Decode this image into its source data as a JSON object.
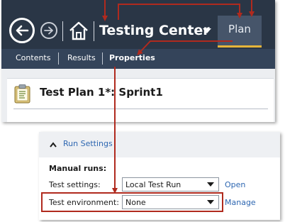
{
  "header": {
    "title": "Testing Center",
    "plan_tab": "Plan"
  },
  "subnav": {
    "tabs": [
      {
        "label": "Contents"
      },
      {
        "label": "Results"
      },
      {
        "label": "Properties",
        "selected": true
      }
    ]
  },
  "plan": {
    "title": "Test Plan 1*: Sprint1"
  },
  "run_settings": {
    "section_label": "Run Settings",
    "manual_runs_label": "Manual runs:",
    "test_settings": {
      "label": "Test settings:",
      "value": "Local Test Run",
      "action": "Open"
    },
    "test_environment": {
      "label": "Test environment:",
      "value": "None",
      "action": "Manage"
    }
  },
  "colors": {
    "title_bar": "#2a3646",
    "sub_bar": "#34445a",
    "plan_tab_accent": "#e6b53a",
    "link": "#2e67b1",
    "callout": "#b02a1e"
  }
}
